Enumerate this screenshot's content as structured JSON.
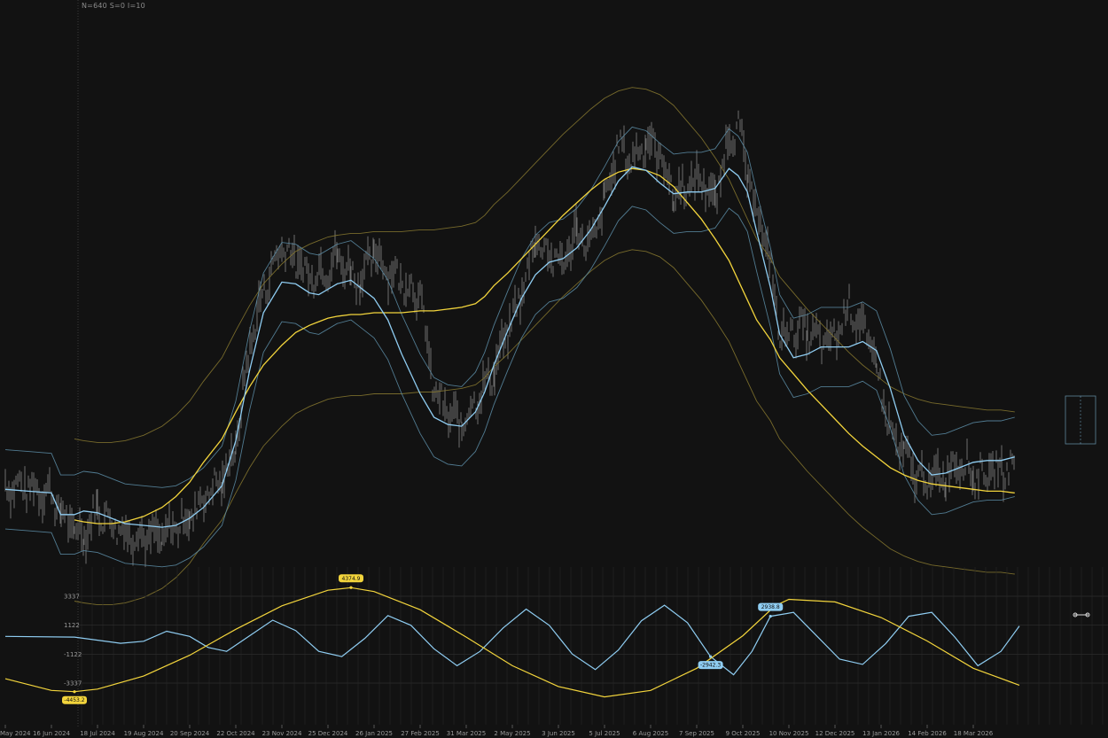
{
  "header": {
    "info": "N=640  S=0  I=10"
  },
  "colors": {
    "background": "#121212",
    "price": "#6e6e6e",
    "fast": "#8fcdf2",
    "slow": "#f2d43c",
    "grid": "#262626",
    "axis_text": "#9a9a9a",
    "selection": "#7fb6d6"
  },
  "chart_data": [
    {
      "type": "line",
      "title": "",
      "x_ticks": [
        "May 2024",
        "16 Jun 2024",
        "18 Jul 2024",
        "19 Aug 2024",
        "20 Sep 2024",
        "22 Oct 2024",
        "23 Nov 2024",
        "25 Dec 2024",
        "26 Jan 2025",
        "27 Feb 2025",
        "31 Mar 2025",
        "2 May 2025",
        "3 Jun 2025",
        "5 Jul 2025",
        "6 Aug 2025",
        "7 Sep 2025",
        "9 Oct 2025",
        "10 Nov 2025",
        "12 Dec 2025",
        "13 Jan 2026",
        "14 Feb 2026",
        "18 Mar 2026"
      ],
      "x_range_index": [
        0,
        22.5
      ],
      "grid": false,
      "series": [
        {
          "role": "price",
          "x": [
            0,
            0.5,
            1,
            1.2,
            1.5,
            1.7,
            2,
            2.3,
            2.6,
            3,
            3.4,
            3.7,
            4,
            4.3,
            4.7,
            5,
            5.3,
            5.6,
            6,
            6.3,
            6.6,
            6.8,
            7,
            7.2,
            7.5,
            7.7,
            8,
            8.3,
            8.6,
            9,
            9.3,
            9.6,
            9.9,
            10.2,
            10.4,
            10.6,
            10.9,
            11.2,
            11.5,
            11.8,
            12.1,
            12.4,
            12.7,
            13,
            13.3,
            13.6,
            13.9,
            14.2,
            14.5,
            14.8,
            15.1,
            15.4,
            15.7,
            15.9,
            16.1,
            16.3,
            16.6,
            16.8,
            17.1,
            17.4,
            17.7,
            18,
            18.3,
            18.6,
            18.9,
            19.2,
            19.5,
            19.8,
            20.1,
            20.4,
            20.7,
            21,
            21.3,
            21.6,
            21.9
          ],
          "y": [
            6000,
            5900,
            5600,
            4500,
            3600,
            3300,
            4700,
            4000,
            3400,
            3200,
            3100,
            3800,
            4200,
            5400,
            6300,
            8200,
            13800,
            16800,
            19400,
            18500,
            17600,
            17900,
            18100,
            18700,
            17800,
            17400,
            19000,
            18000,
            17400,
            16600,
            11200,
            10000,
            9400,
            10800,
            11500,
            12400,
            14600,
            16600,
            19800,
            18800,
            18300,
            20200,
            19200,
            21700,
            24900,
            24000,
            25200,
            24400,
            22200,
            22600,
            23100,
            21800,
            25400,
            26000,
            23200,
            21400,
            18300,
            14300,
            14700,
            14600,
            13900,
            14200,
            16000,
            14800,
            12700,
            8900,
            7700,
            6500,
            6300,
            6700,
            7500,
            6600,
            6700,
            6900,
            7000
          ]
        },
        {
          "role": "fast-smooth",
          "color": "#8fcdf2",
          "x": [
            0,
            0.5,
            1,
            1.2,
            1.5,
            1.7,
            2,
            2.3,
            2.6,
            3,
            3.4,
            3.7,
            4,
            4.3,
            4.7,
            5,
            5.3,
            5.6,
            6,
            6.3,
            6.6,
            6.8,
            7,
            7.2,
            7.5,
            7.7,
            8,
            8.3,
            8.6,
            9,
            9.3,
            9.6,
            9.9,
            10.2,
            10.4,
            10.6,
            10.9,
            11.2,
            11.5,
            11.8,
            12.1,
            12.4,
            12.7,
            13,
            13.3,
            13.6,
            13.9,
            14.2,
            14.5,
            14.8,
            15.1,
            15.4,
            15.7,
            15.9,
            16.1,
            16.3,
            16.6,
            16.8,
            17.1,
            17.4,
            17.7,
            18,
            18.3,
            18.6,
            18.9,
            19.2,
            19.5,
            19.8,
            20.1,
            20.4,
            20.7,
            21,
            21.3,
            21.6,
            21.9
          ],
          "y": [
            5800,
            5700,
            5600,
            4400,
            4400,
            4600,
            4500,
            4200,
            3900,
            3800,
            3700,
            3800,
            4200,
            4800,
            6000,
            8500,
            12400,
            15600,
            17300,
            17200,
            16700,
            16600,
            16900,
            17200,
            17400,
            17000,
            16400,
            15200,
            13300,
            11100,
            9800,
            9400,
            9300,
            10100,
            11200,
            12700,
            14600,
            16400,
            17700,
            18400,
            18600,
            19200,
            20200,
            21500,
            22900,
            23700,
            23500,
            22800,
            22200,
            22300,
            22300,
            22500,
            23600,
            23200,
            22300,
            20100,
            17000,
            14400,
            13100,
            13300,
            13700,
            13700,
            13700,
            14000,
            13500,
            11400,
            8800,
            7400,
            6600,
            6700,
            7000,
            7300,
            7400,
            7400,
            7600
          ]
        },
        {
          "role": "slow-smooth",
          "color": "#f2d43c",
          "x": [
            0,
            0.5,
            1,
            1.2,
            1.5,
            1.7,
            2,
            2.3,
            2.6,
            3,
            3.4,
            3.7,
            4,
            4.3,
            4.7,
            5,
            5.3,
            5.6,
            6,
            6.3,
            6.6,
            6.8,
            7,
            7.2,
            7.5,
            7.7,
            8,
            8.3,
            8.6,
            9,
            9.3,
            9.6,
            9.9,
            10.2,
            10.4,
            10.6,
            10.9,
            11.2,
            11.5,
            11.8,
            12.1,
            12.4,
            12.7,
            13,
            13.3,
            13.6,
            13.9,
            14.2,
            14.5,
            14.8,
            15.1,
            15.4,
            15.7,
            15.9,
            16.1,
            16.3,
            16.6,
            16.8,
            17.1,
            17.4,
            17.7,
            18,
            18.3,
            18.6,
            18.9,
            19.2,
            19.5,
            19.8,
            20.1,
            20.4,
            20.7,
            21,
            21.3,
            21.6,
            21.9
          ],
          "y": [
            null,
            null,
            null,
            null,
            4100,
            4000,
            3900,
            3900,
            4000,
            4300,
            4800,
            5400,
            6200,
            7300,
            8600,
            10100,
            11500,
            12700,
            13800,
            14500,
            14900,
            15100,
            15300,
            15400,
            15500,
            15500,
            15600,
            15600,
            15600,
            15700,
            15700,
            15800,
            15900,
            16100,
            16500,
            17100,
            17800,
            18600,
            19400,
            20200,
            21000,
            21700,
            22400,
            23000,
            23400,
            23600,
            23500,
            23200,
            22600,
            21700,
            20800,
            19700,
            18500,
            17400,
            16300,
            15200,
            14100,
            13100,
            12200,
            11300,
            10500,
            9700,
            8900,
            8200,
            7600,
            7000,
            6600,
            6300,
            6100,
            6000,
            5900,
            5800,
            5700,
            5700,
            5600
          ]
        }
      ]
    },
    {
      "type": "line",
      "y_ticks": [
        3337,
        1122,
        -1122,
        -3337
      ],
      "series": [
        {
          "role": "fast-cycle",
          "color": "#8fcdf2",
          "x": [
            0,
            1.5,
            2.5,
            3,
            3.5,
            4,
            4.4,
            4.8,
            5.3,
            5.8,
            6.3,
            6.8,
            7.3,
            7.8,
            8.3,
            8.8,
            9.3,
            9.8,
            10.3,
            10.8,
            11.3,
            11.8,
            12.3,
            12.8,
            13.3,
            13.8,
            14.3,
            14.8,
            15.3,
            15.8,
            16.2,
            16.6,
            17.1,
            17.6,
            18.1,
            18.6,
            19.1,
            19.6,
            20.1,
            20.6,
            21.1,
            21.6,
            22.0
          ],
          "y": [
            250,
            200,
            -280,
            -120,
            650,
            250,
            -600,
            -900,
            300,
            1500,
            700,
            -900,
            -1300,
            100,
            1850,
            1100,
            -700,
            -2000,
            -900,
            900,
            2350,
            1100,
            -1100,
            -2300,
            -800,
            1450,
            2650,
            1300,
            -1300,
            -2700,
            -900,
            1800,
            2100,
            300,
            -1500,
            -1900,
            -300,
            1800,
            2100,
            200,
            -2000,
            -900,
            1050
          ]
        },
        {
          "role": "slow-cycle",
          "color": "#f2d43c",
          "x": [
            0,
            1,
            1.5,
            2,
            3,
            4,
            5,
            6,
            7,
            7.5,
            8,
            9,
            10,
            11,
            12,
            13,
            14,
            15,
            16,
            16.7,
            17,
            18,
            19,
            20,
            21,
            22.0
          ],
          "y": [
            -3000,
            -3900,
            -4000,
            -3800,
            -2800,
            -1200,
            800,
            2600,
            3800,
            4000,
            3700,
            2300,
            200,
            -2000,
            -3600,
            -4400,
            -3900,
            -2200,
            300,
            2600,
            3100,
            2900,
            1700,
            -100,
            -2200,
            -3500
          ]
        }
      ],
      "labels": [
        {
          "text": "4374.9",
          "color": "#f2d43c",
          "x": 7.5
        },
        {
          "text": "-4453.2",
          "color": "#f2d43c",
          "x": 1.5
        },
        {
          "text": "2938.8",
          "color": "#8fcdf2",
          "x": 16.7
        },
        {
          "text": "-2942.3",
          "color": "#8fcdf2",
          "x": 15.3
        }
      ]
    }
  ]
}
